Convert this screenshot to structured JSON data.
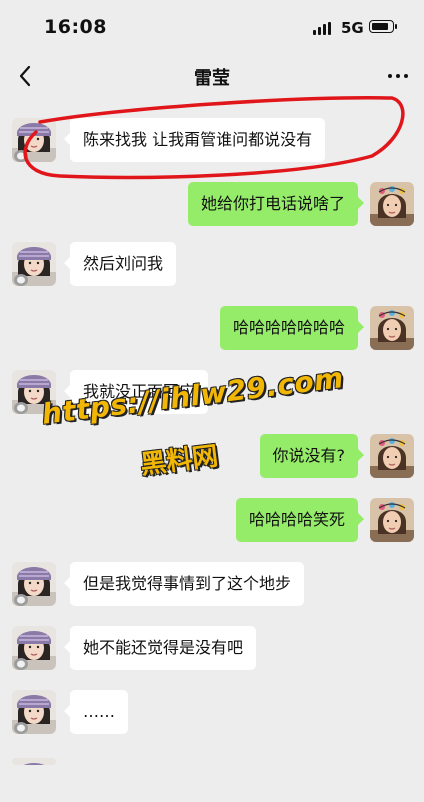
{
  "status_bar": {
    "time": "16:08",
    "network": "5G",
    "battery_level": 0.85
  },
  "nav": {
    "title": "雷莹",
    "back_icon": "chevron-left-icon",
    "more_icon": "more-dots-icon"
  },
  "messages": [
    {
      "side": "them",
      "text": "陈来找我 让我甭管谁问都说没有"
    },
    {
      "side": "me",
      "text": "她给你打电话说啥了"
    },
    {
      "side": "them",
      "text": "然后刘问我"
    },
    {
      "side": "me",
      "text": "哈哈哈哈哈哈哈"
    },
    {
      "side": "them",
      "text": "我就没正面回应"
    },
    {
      "side": "me",
      "text": "你说没有?"
    },
    {
      "side": "me",
      "text": "哈哈哈哈笑死"
    },
    {
      "side": "them",
      "text": "但是我觉得事情到了这个地步"
    },
    {
      "side": "them",
      "text": "她不能还觉得是没有吧"
    },
    {
      "side": "them",
      "text": "……"
    }
  ],
  "watermark": {
    "url": "https://ihlw29.com",
    "name": "黑料网",
    "color": "#f2b705"
  },
  "colors": {
    "background": "#ededed",
    "my_bubble": "#95ec69",
    "their_bubble": "#ffffff",
    "annotation": "#e0161b"
  }
}
